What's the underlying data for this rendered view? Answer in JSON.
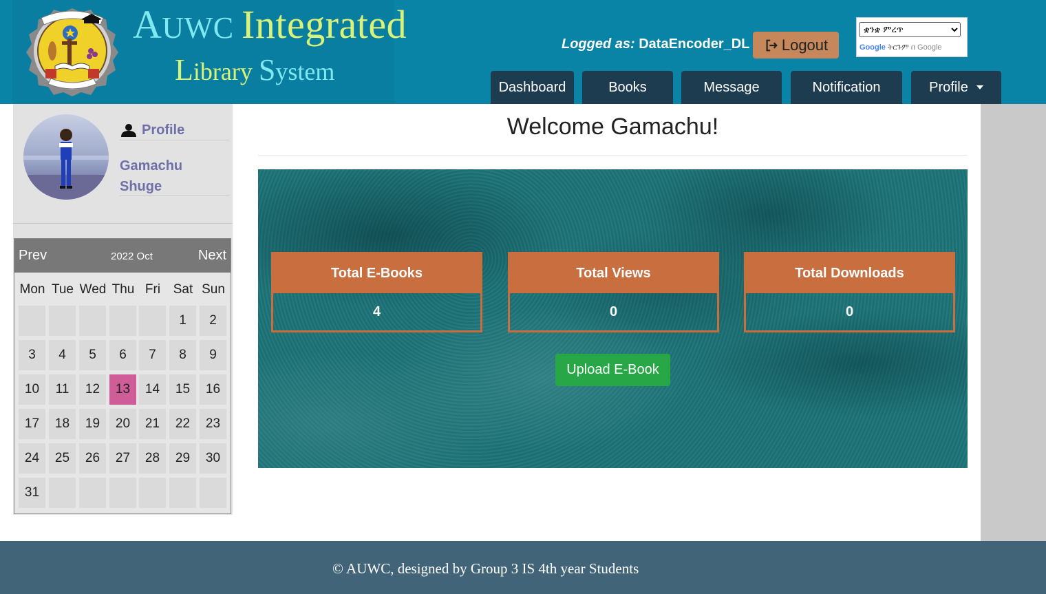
{
  "brand": {
    "line1_cap": "A",
    "line1_rest": "UWC ",
    "line1_cap2": "I",
    "line1_tail": "ntegrated",
    "line2_cap": "L",
    "line2_rest": "ibrary ",
    "line2_cap2": "S",
    "line2_tail": "ystem"
  },
  "header": {
    "logged_label": "Logged as:",
    "logged_user": "DataEncoder_DL",
    "logout_label": "Logout",
    "translate_selected": "ቋንቋ ምረጥ",
    "powered_by_prefix": "Google",
    "powered_by_suffix": "ትርጉም",
    "powered_by_tail": "በ Google"
  },
  "nav": {
    "items": [
      {
        "label": "Dashboard"
      },
      {
        "label": "Books"
      },
      {
        "label": "Message"
      },
      {
        "label": "Notification"
      },
      {
        "label": "Profile"
      }
    ]
  },
  "sidebar": {
    "profile_heading": "Profile",
    "first_name": "Gamachu",
    "last_name": "Shuge"
  },
  "calendar": {
    "prev_label": "Prev",
    "next_label": "Next",
    "title": "2022 Oct",
    "days_of_week": [
      "Mon",
      "Tue",
      "Wed",
      "Thu",
      "Fri",
      "Sat",
      "Sun"
    ],
    "first_weekday_index": 5,
    "days_in_month": 31,
    "today": 13
  },
  "main": {
    "welcome": "Welcome Gamachu!",
    "stats": [
      {
        "label": "Total E-Books",
        "value": "4"
      },
      {
        "label": "Total Views",
        "value": "0"
      },
      {
        "label": "Total Downloads",
        "value": "0"
      }
    ],
    "upload_label": "Upload E-Book"
  },
  "footer": {
    "text": "© AUWC, designed by Group 3 IS 4th year Students"
  },
  "colors": {
    "header_bg": "#0a84a6",
    "nav_bg": "#1d3c4f",
    "logout_bg": "#c6875a",
    "stat_accent": "#c96e3f",
    "upload_bg": "#27a745",
    "today_bg": "#cf5e98",
    "footer_bg": "#426478",
    "sidebar_text": "#6f6fa8"
  }
}
